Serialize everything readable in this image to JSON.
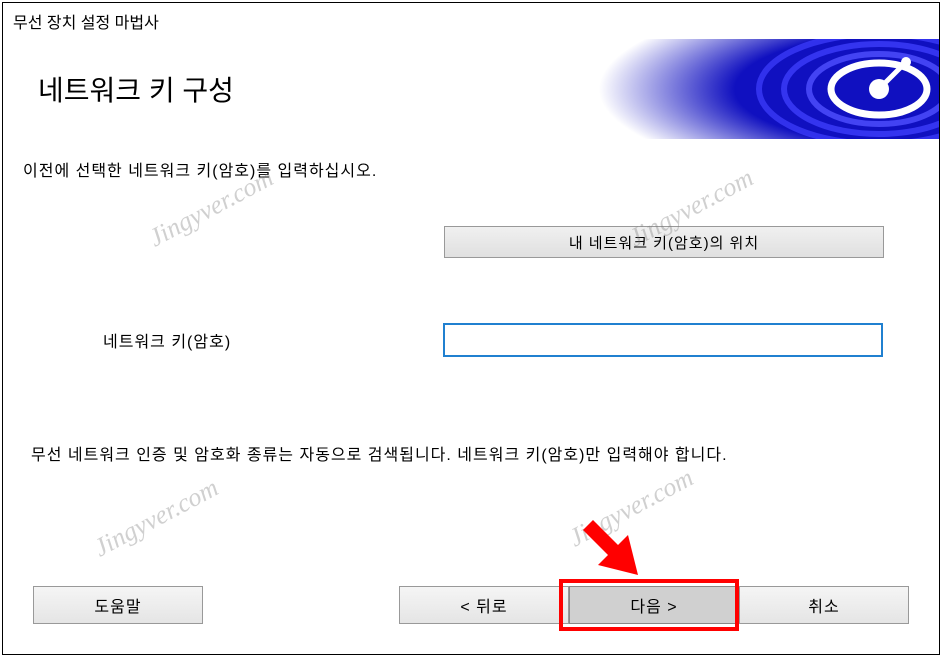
{
  "window": {
    "title": "무선 장치 설정 마법사"
  },
  "header": {
    "title": "네트워크 키 구성"
  },
  "content": {
    "instruction": "이전에 선택한 네트워크 키(암호)를 입력하십시오.",
    "location_button_label": "내 네트워크 키(암호)의 위치",
    "input_label": "네트워크 키(암호)",
    "input_value": "",
    "info_text": "무선 네트워크 인증 및 암호화 종류는 자동으로 검색됩니다. 네트워크 키(암호)만 입력해야 합니다."
  },
  "footer": {
    "help_label": "도움말",
    "back_label": "< 뒤로",
    "next_label": "다음 >",
    "cancel_label": "취소"
  },
  "watermark": {
    "text": "Jingyver.com"
  }
}
